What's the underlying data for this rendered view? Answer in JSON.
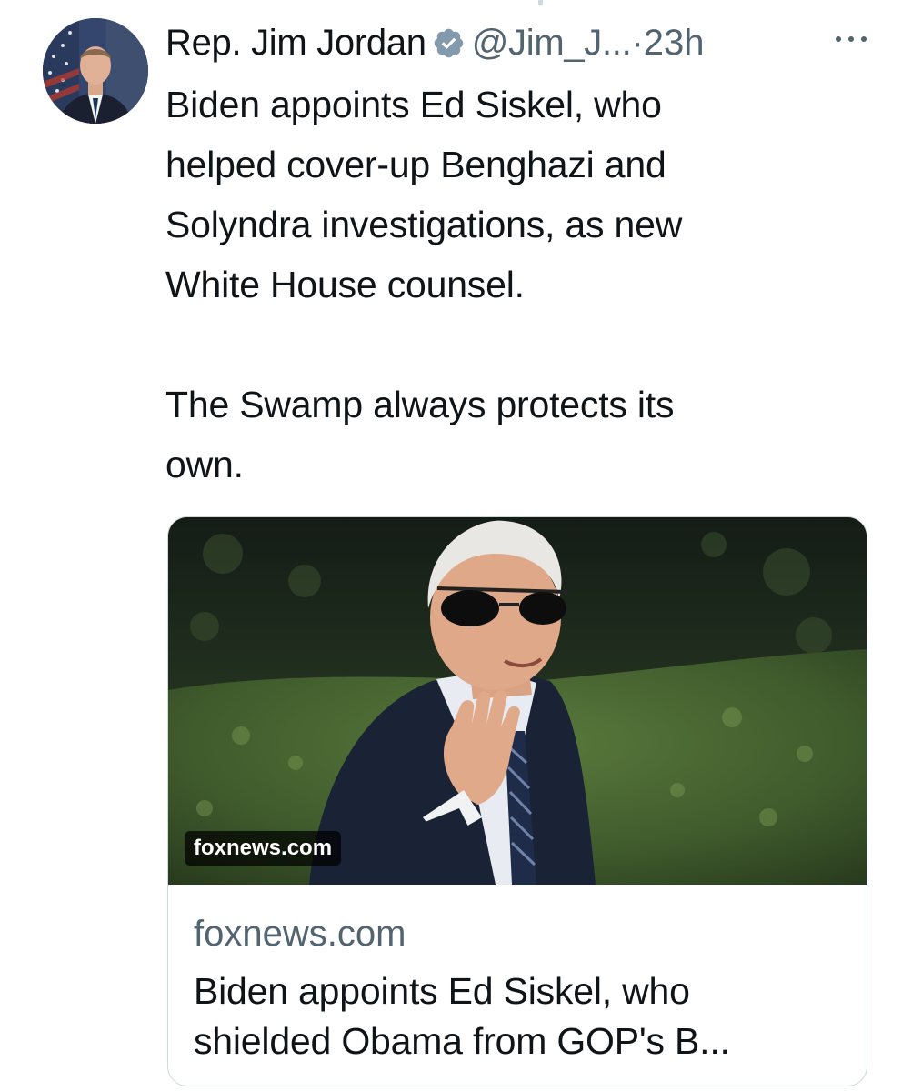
{
  "tweet": {
    "author": {
      "display_name": "Rep. Jim Jordan",
      "handle": "@Jim_J...",
      "verified_icon": "verified-badge-icon",
      "avatar_icon": "avatar"
    },
    "separator": "·",
    "timestamp": "23h",
    "more_icon": "more-options-icon",
    "text": "Biden appoints Ed Siskel, who\nhelped cover-up Benghazi and\nSolyndra investigations, as new\nWhite House counsel.\n\nThe Swamp always protects its\nown.",
    "link_card": {
      "image_badge": "foxnews.com",
      "domain": "foxnews.com",
      "title": "Biden appoints Ed Siskel, who\nshielded Obama from GOP's B..."
    }
  },
  "colors": {
    "text_primary": "#0f1419",
    "text_secondary": "#536471",
    "border": "#cfd9de",
    "background": "#ffffff"
  }
}
